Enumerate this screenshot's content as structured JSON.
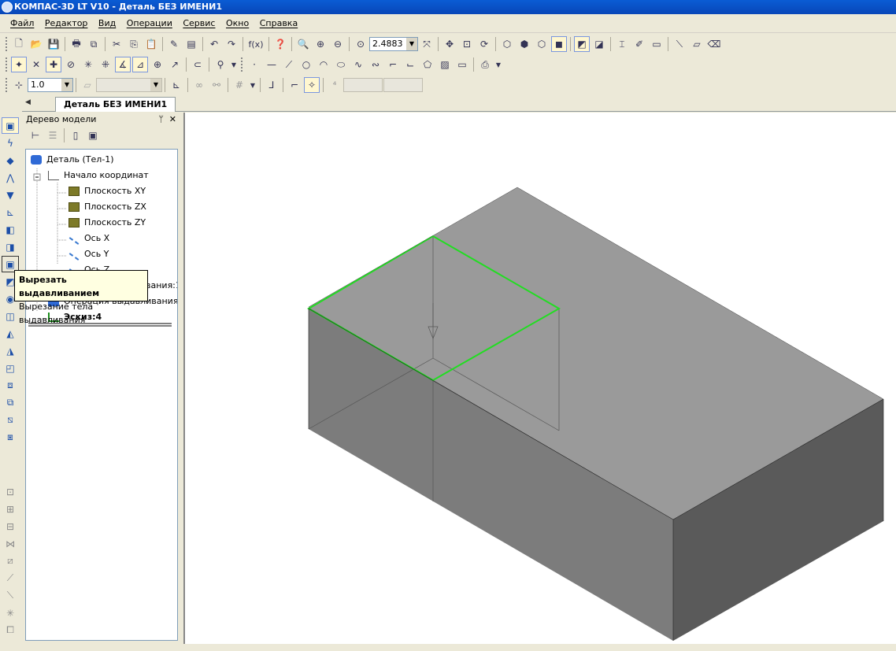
{
  "window": {
    "title": "КОМПАС-3D LT V10 - Деталь БЕЗ ИМЕНИ1"
  },
  "menu": [
    "Файл",
    "Редактор",
    "Вид",
    "Операции",
    "Сервис",
    "Окно",
    "Справка"
  ],
  "toolbar": {
    "zoom_value": "2.4883",
    "line_scale_value": "1.0",
    "fx_label": "f(x)"
  },
  "document_tab": {
    "label": "Деталь БЕЗ ИМЕНИ1"
  },
  "model_tree": {
    "title": "Дерево модели",
    "root": "Деталь (Тел-1)",
    "origin": "Начало координат",
    "items": [
      "Плоскость XY",
      "Плоскость ZX",
      "Плоскость ZY",
      "Ось X",
      "Ось Y",
      "Ось Z"
    ],
    "op1": "Операция выдавливания:1",
    "op2": "Операция выдавливания:2",
    "op1_visible": "вания:1",
    "op2_visible": "Операция выдавливания:2",
    "sketch": "Эскиз:4"
  },
  "tooltip": {
    "title": "Вырезать выдавливанием",
    "text": "Вырезание тела выдавливания"
  },
  "colors": {
    "title_bar": "#0a5cd4",
    "sketch_outline": "#22dd22",
    "solid_top": "#9a9a9a",
    "solid_front": "#7c7c7c",
    "solid_side": "#5a5a5a"
  }
}
